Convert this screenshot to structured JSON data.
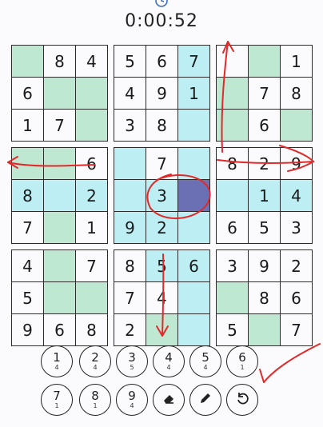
{
  "timer": {
    "value": "0:00:52"
  },
  "colors": {
    "given_green": "#bfe8d2",
    "highlight_cyan": "#bdeef4",
    "selected": "#6b6fb4",
    "annotation": "#e02a2a"
  },
  "grid": [
    [
      "",
      "8",
      "4",
      "5",
      "6",
      "7",
      "",
      "",
      "1"
    ],
    [
      "6",
      "",
      "",
      "4",
      "9",
      "1",
      "",
      "7",
      "8"
    ],
    [
      "1",
      "7",
      "",
      "3",
      "8",
      "",
      "",
      "6",
      ""
    ],
    [
      "",
      "",
      "6",
      "",
      "7",
      "",
      "8",
      "2",
      "9"
    ],
    [
      "8",
      "",
      "2",
      "",
      "3",
      "",
      "",
      "1",
      "4"
    ],
    [
      "7",
      "",
      "1",
      "9",
      "2",
      "",
      "6",
      "5",
      "3"
    ],
    [
      "4",
      "",
      "7",
      "8",
      "5",
      "6",
      "3",
      "9",
      "2"
    ],
    [
      "5",
      "",
      "",
      "7",
      "4",
      "",
      "",
      "8",
      "6"
    ],
    [
      "9",
      "6",
      "8",
      "2",
      "",
      "",
      "5",
      "",
      "7"
    ]
  ],
  "keypad": [
    {
      "digit": "1",
      "count": "4"
    },
    {
      "digit": "2",
      "count": "4"
    },
    {
      "digit": "3",
      "count": "5"
    },
    {
      "digit": "4",
      "count": "4"
    },
    {
      "digit": "5",
      "count": "4"
    },
    {
      "digit": "6",
      "count": "1"
    },
    {
      "digit": "7",
      "count": "1"
    },
    {
      "digit": "8",
      "count": "1"
    },
    {
      "digit": "9",
      "count": "4"
    }
  ],
  "tools": [
    {
      "name": "eraser-icon"
    },
    {
      "name": "pencil-icon"
    },
    {
      "name": "undo-icon"
    }
  ]
}
